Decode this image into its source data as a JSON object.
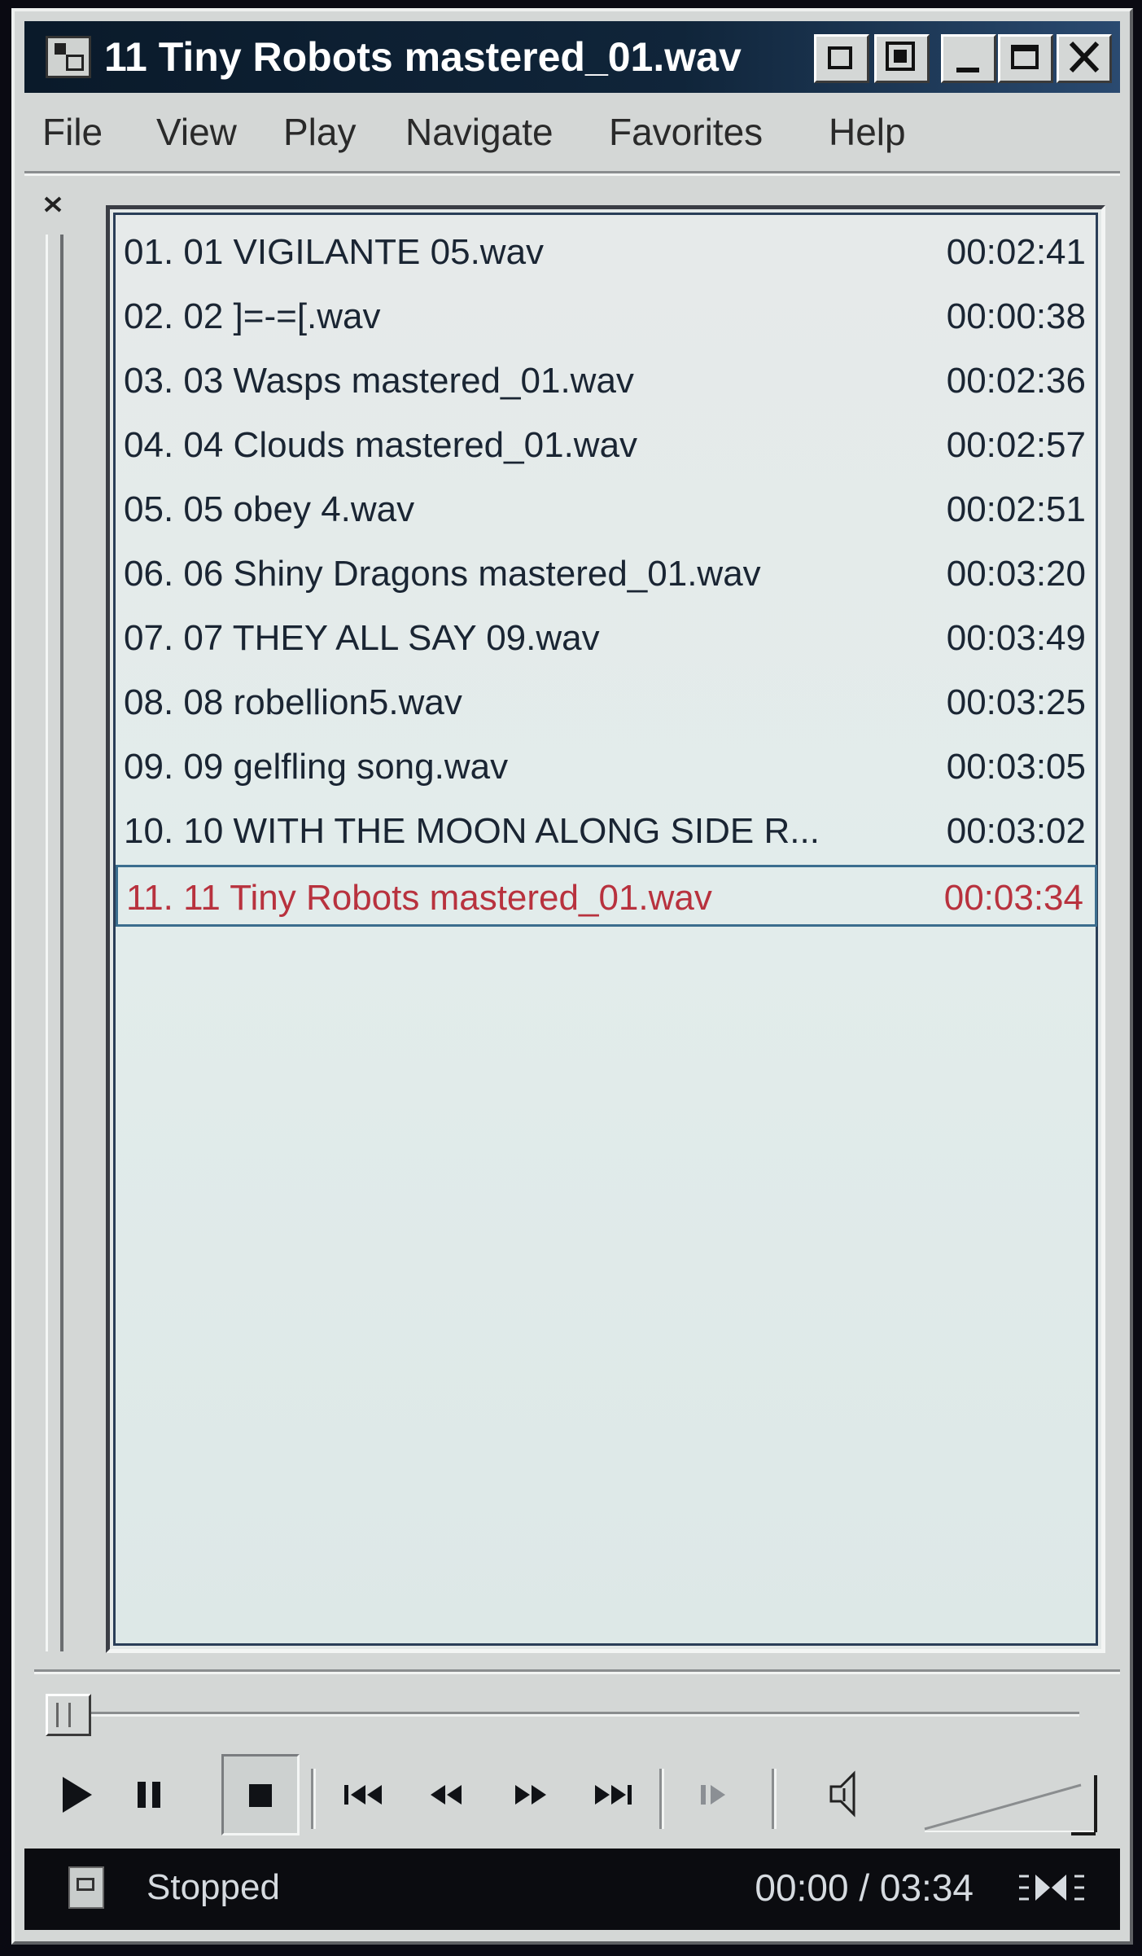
{
  "window": {
    "title": "11 Tiny Robots mastered_01.wav"
  },
  "title_buttons": {
    "mode_icon": "switch-to-full-mode-icon",
    "skin_icon": "skin-mode-icon",
    "minimize_icon": "minimize-icon",
    "maximize_icon": "maximize-icon",
    "close_icon": "close-icon"
  },
  "menu": {
    "items": [
      {
        "label": "File"
      },
      {
        "label": "View"
      },
      {
        "label": "Play"
      },
      {
        "label": "Navigate"
      },
      {
        "label": "Favorites"
      },
      {
        "label": "Help"
      }
    ]
  },
  "playlist": {
    "tracks": [
      {
        "name": "01. 01 VIGILANTE 05.wav",
        "duration": "00:02:41"
      },
      {
        "name": "02. 02 ]=-=[.wav",
        "duration": "00:00:38"
      },
      {
        "name": "03. 03 Wasps mastered_01.wav",
        "duration": "00:02:36"
      },
      {
        "name": "04. 04 Clouds mastered_01.wav",
        "duration": "00:02:57"
      },
      {
        "name": "05. 05 obey 4.wav",
        "duration": "00:02:51"
      },
      {
        "name": "06. 06 Shiny Dragons mastered_01.wav",
        "duration": "00:03:20"
      },
      {
        "name": "07. 07 THEY ALL SAY 09.wav",
        "duration": "00:03:49"
      },
      {
        "name": "08. 08 robellion5.wav",
        "duration": "00:03:25"
      },
      {
        "name": "09. 09 gelfling song.wav",
        "duration": "00:03:05"
      },
      {
        "name": "10. 10 WITH THE MOON ALONG SIDE R...",
        "duration": "00:03:02"
      },
      {
        "name": "11. 11 Tiny Robots mastered_01.wav",
        "duration": "00:03:34",
        "active": true
      }
    ],
    "active_color": "#b8323e",
    "text_color": "#1a2533"
  },
  "seek": {
    "position_fraction": 0
  },
  "controls": {
    "play_icon": "play-icon",
    "pause_icon": "pause-icon",
    "stop_icon": "stop-icon",
    "previous_icon": "previous-track-icon",
    "rewind_icon": "rewind-icon",
    "fast_forward_icon": "fast-forward-icon",
    "next_icon": "next-track-icon",
    "frame_step_icon": "frame-step-icon",
    "mute_icon": "speaker-icon",
    "volume_level_fraction": 0.85
  },
  "status": {
    "state": "Stopped",
    "time": "00:00 / 03:34",
    "view_icon": "view-mode-icon"
  }
}
